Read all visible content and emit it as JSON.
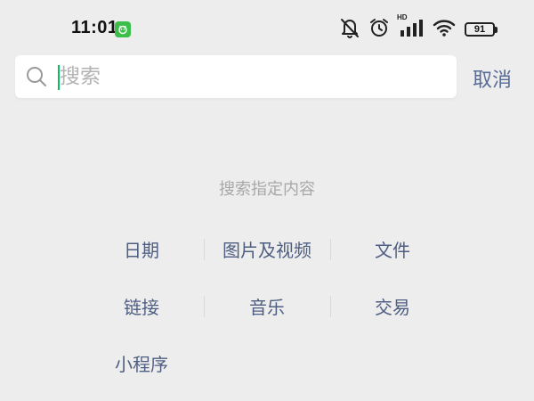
{
  "status_bar": {
    "time": "11:01",
    "hd_label": "HD",
    "battery_level": "91",
    "icons": [
      "app-notification-icon",
      "bell-muted-icon",
      "alarm-clock-icon",
      "cellular-signal-icon",
      "wifi-icon",
      "battery-icon"
    ]
  },
  "search": {
    "placeholder": "搜索",
    "value": "",
    "cancel_label": "取消",
    "icon": "search-icon"
  },
  "categories": {
    "title": "搜索指定内容",
    "items": [
      {
        "label": "日期"
      },
      {
        "label": "图片及视频"
      },
      {
        "label": "文件"
      },
      {
        "label": "链接"
      },
      {
        "label": "音乐"
      },
      {
        "label": "交易"
      },
      {
        "label": "小程序"
      }
    ]
  },
  "colors": {
    "background": "#ededed",
    "link": "#576b95",
    "category_text": "#4e5e82",
    "cursor": "#07c160",
    "muted_text": "#a8a8a8"
  }
}
